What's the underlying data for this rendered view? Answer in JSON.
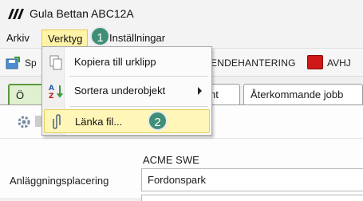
{
  "window": {
    "title": "Gula Bettan ABC12A"
  },
  "menubar": {
    "items": [
      "Arkiv",
      "Verktyg",
      "Inställningar"
    ]
  },
  "toolbar": {
    "sp_label": "Sp",
    "enhet_label": "ENDEHANTERING",
    "avhj_label": "AVHJ"
  },
  "tabs": {
    "ov_label": "Ö",
    "ment_label": "ment",
    "aterk_label": "Återkommande jobb"
  },
  "dropdown": {
    "items": [
      {
        "label": "Kopiera till urklipp",
        "icon": "copy-icon"
      },
      {
        "label": "Sortera underobjekt",
        "icon": "sort-az-icon",
        "submenu": true
      },
      {
        "label": "Länka fil...",
        "icon": "paperclip-icon",
        "highlighted": true
      }
    ]
  },
  "badges": [
    "1",
    "2"
  ],
  "content": {
    "group_label": "ACME SWE",
    "field_label": "Anläggningsplacering",
    "field_value": "Fordonspark"
  },
  "colors": {
    "accent": "#3e8e78",
    "highlight": "#fff6b8",
    "red_button": "#d01818"
  }
}
